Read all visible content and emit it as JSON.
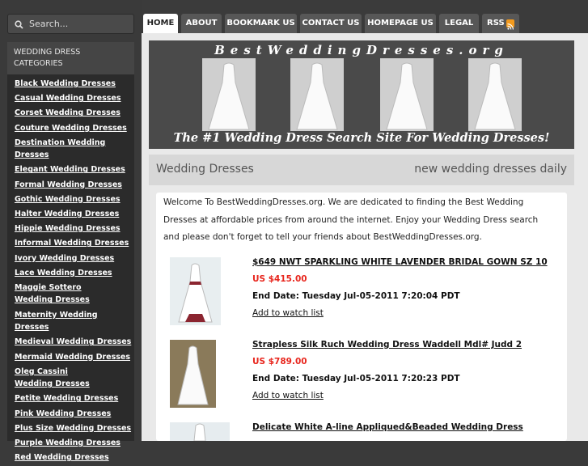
{
  "search": {
    "placeholder": "Search..."
  },
  "sidebar": {
    "heading": "WEDDING DRESS CATEGORIES",
    "items": [
      "Black Wedding Dresses",
      "Casual Wedding Dresses",
      "Corset Wedding Dresses",
      "Couture Wedding Dresses",
      "Destination Wedding Dresses",
      "Elegant Wedding Dresses",
      "Formal Wedding Dresses",
      "Gothic Wedding Dresses",
      "Halter Wedding Dresses",
      "Hippie Wedding Dresses",
      "Informal Wedding Dresses",
      "Ivory Wedding Dresses",
      "Lace Wedding Dresses",
      "Maggie Sottero Wedding Dresses",
      "Maternity Wedding Dresses",
      "Medieval Wedding Dresses",
      "Mermaid Wedding Dresses",
      "Oleg Cassini Wedding Dresses",
      "Petite Wedding Dresses",
      "Pink Wedding Dresses",
      "Plus Size Wedding Dresses",
      "Purple Wedding Dresses",
      "Red Wedding Dresses"
    ]
  },
  "nav": {
    "tabs": [
      "HOME",
      "ABOUT",
      "BOOKMARK US",
      "CONTACT US",
      "HOMEPAGE US",
      "LEGAL",
      "RSS"
    ],
    "active": "HOME"
  },
  "banner": {
    "title": "BestWeddingDresses.org",
    "tagline": "The #1 Wedding Dress Search Site For Wedding Dresses!"
  },
  "header": {
    "left": "Wedding Dresses",
    "right": "new wedding dresses daily"
  },
  "intro": "Welcome To BestWeddingDresses.org. We are dedicated to finding the Best Wedding Dresses at affordable prices from around the internet. Enjoy your Wedding Dress search and please don't forget to tell your friends about BestWeddingDresses.org.",
  "listings": [
    {
      "title": "$649 NWT SPARKLING WHITE LAVENDER BRIDAL GOWN SZ 10 ",
      "price": "US $415.00",
      "end": "End Date: Tuesday Jul-05-2011 7:20:04 PDT",
      "watch": "Add to watch list"
    },
    {
      "title": "Strapless Silk Ruch Wedding Dress Waddell Mdl# Judd 2",
      "price": "US $789.00",
      "end": "End Date: Tuesday Jul-05-2011 7:20:23 PDT",
      "watch": "Add to watch list"
    },
    {
      "title": "Delicate White A-line Appliqued&Beaded Wedding Dress",
      "price": "",
      "end": "",
      "watch": ""
    }
  ],
  "colors": {
    "accent_price": "#e8261d",
    "tab_bg": "#575757",
    "active_tab_bg": "#ffffff",
    "rss": "#f39a1d"
  }
}
